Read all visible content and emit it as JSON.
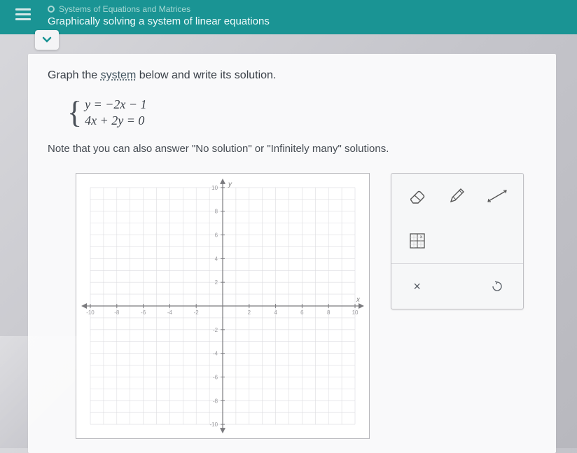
{
  "header": {
    "breadcrumb": "Systems of Equations and Matrices",
    "title": "Graphically solving a system of linear equations"
  },
  "prompt": {
    "pre": "Graph the ",
    "link": "system",
    "post": " below and write its solution."
  },
  "equations": {
    "eq1": "y = −2x − 1",
    "eq2": "4x + 2y = 0"
  },
  "note": "Note that you can also answer \"No solution\" or \"Infinitely many\" solutions.",
  "graph": {
    "xmin": -10,
    "xmax": 10,
    "ymin": -10,
    "ymax": 10,
    "ylabel": "y",
    "xlabel": "x",
    "ticks": [
      -10,
      -8,
      -6,
      -4,
      -2,
      2,
      4,
      6,
      8,
      10
    ]
  },
  "tools": {
    "clear": "×",
    "reset": "↺"
  }
}
